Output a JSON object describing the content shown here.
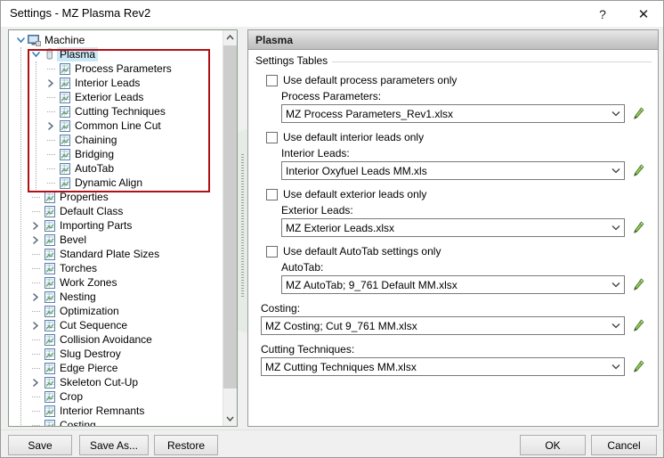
{
  "window": {
    "title": "Settings - MZ Plasma Rev2",
    "help_label": "?",
    "close_label": "✕"
  },
  "tree": {
    "nodes": [
      {
        "label": "Machine",
        "depth": 0,
        "expander": "expanded",
        "icon": "monitor-icon",
        "selected": false
      },
      {
        "label": "Plasma",
        "depth": 1,
        "expander": "expanded",
        "icon": "torch-icon",
        "selected": true
      },
      {
        "label": "Process Parameters",
        "depth": 2,
        "expander": "none",
        "icon": "spreadsheet-icon",
        "selected": false
      },
      {
        "label": "Interior Leads",
        "depth": 2,
        "expander": "collapsed",
        "icon": "spreadsheet-icon",
        "selected": false
      },
      {
        "label": "Exterior Leads",
        "depth": 2,
        "expander": "none",
        "icon": "spreadsheet-icon",
        "selected": false
      },
      {
        "label": "Cutting Techniques",
        "depth": 2,
        "expander": "none",
        "icon": "spreadsheet-icon",
        "selected": false
      },
      {
        "label": "Common Line Cut",
        "depth": 2,
        "expander": "collapsed",
        "icon": "spreadsheet-icon",
        "selected": false
      },
      {
        "label": "Chaining",
        "depth": 2,
        "expander": "none",
        "icon": "spreadsheet-icon",
        "selected": false
      },
      {
        "label": "Bridging",
        "depth": 2,
        "expander": "none",
        "icon": "spreadsheet-icon",
        "selected": false
      },
      {
        "label": "AutoTab",
        "depth": 2,
        "expander": "none",
        "icon": "spreadsheet-icon",
        "selected": false
      },
      {
        "label": "Dynamic Align",
        "depth": 2,
        "expander": "none",
        "icon": "spreadsheet-icon",
        "selected": false
      },
      {
        "label": "Properties",
        "depth": 1,
        "expander": "none",
        "icon": "spreadsheet-icon",
        "selected": false
      },
      {
        "label": "Default Class",
        "depth": 1,
        "expander": "none",
        "icon": "spreadsheet-icon",
        "selected": false
      },
      {
        "label": "Importing Parts",
        "depth": 1,
        "expander": "collapsed",
        "icon": "spreadsheet-icon",
        "selected": false
      },
      {
        "label": "Bevel",
        "depth": 1,
        "expander": "collapsed",
        "icon": "spreadsheet-icon",
        "selected": false
      },
      {
        "label": "Standard Plate Sizes",
        "depth": 1,
        "expander": "none",
        "icon": "spreadsheet-icon",
        "selected": false
      },
      {
        "label": "Torches",
        "depth": 1,
        "expander": "none",
        "icon": "spreadsheet-icon",
        "selected": false
      },
      {
        "label": "Work Zones",
        "depth": 1,
        "expander": "none",
        "icon": "spreadsheet-icon",
        "selected": false
      },
      {
        "label": "Nesting",
        "depth": 1,
        "expander": "collapsed",
        "icon": "spreadsheet-icon",
        "selected": false
      },
      {
        "label": "Optimization",
        "depth": 1,
        "expander": "none",
        "icon": "spreadsheet-icon",
        "selected": false
      },
      {
        "label": "Cut Sequence",
        "depth": 1,
        "expander": "collapsed",
        "icon": "spreadsheet-icon",
        "selected": false
      },
      {
        "label": "Collision Avoidance",
        "depth": 1,
        "expander": "none",
        "icon": "spreadsheet-icon",
        "selected": false
      },
      {
        "label": "Slug Destroy",
        "depth": 1,
        "expander": "none",
        "icon": "spreadsheet-icon",
        "selected": false
      },
      {
        "label": "Edge Pierce",
        "depth": 1,
        "expander": "none",
        "icon": "spreadsheet-icon",
        "selected": false
      },
      {
        "label": "Skeleton Cut-Up",
        "depth": 1,
        "expander": "collapsed",
        "icon": "spreadsheet-icon",
        "selected": false
      },
      {
        "label": "Crop",
        "depth": 1,
        "expander": "none",
        "icon": "spreadsheet-icon",
        "selected": false
      },
      {
        "label": "Interior Remnants",
        "depth": 1,
        "expander": "none",
        "icon": "spreadsheet-icon",
        "selected": false
      },
      {
        "label": "Costing",
        "depth": 1,
        "expander": "none",
        "icon": "spreadsheet-icon",
        "selected": false
      }
    ],
    "highlight_color": "#b01117",
    "selection_color": "#cbe8f6"
  },
  "panel": {
    "header_title": "Plasma",
    "group_legend": "Settings Tables",
    "fields": [
      {
        "checkbox_label": "Use default process parameters only",
        "checked": false,
        "field_label": "Process Parameters:",
        "value": "MZ Process Parameters_Rev1.xlsx",
        "has_checkbox": true
      },
      {
        "checkbox_label": "Use default interior leads only",
        "checked": false,
        "field_label": "Interior Leads:",
        "value": "Interior Oxyfuel Leads MM.xls",
        "has_checkbox": true
      },
      {
        "checkbox_label": "Use default exterior leads only",
        "checked": false,
        "field_label": "Exterior Leads:",
        "value": "MZ Exterior Leads.xlsx",
        "has_checkbox": true
      },
      {
        "checkbox_label": "Use default AutoTab settings only",
        "checked": false,
        "field_label": "AutoTab:",
        "value": "MZ AutoTab; 9_761 Default MM.xlsx",
        "has_checkbox": true
      },
      {
        "checkbox_label": "",
        "checked": false,
        "field_label": "Costing:",
        "value": "MZ Costing; Cut 9_761 MM.xlsx",
        "has_checkbox": false
      },
      {
        "checkbox_label": "",
        "checked": false,
        "field_label": "Cutting Techniques:",
        "value": "MZ Cutting Techniques MM.xlsx",
        "has_checkbox": false
      }
    ],
    "edit_icon_name": "pencil-icon",
    "dropdown_chevron": "⌄"
  },
  "footer": {
    "save": "Save",
    "save_as": "Save As...",
    "restore": "Restore",
    "ok": "OK",
    "cancel": "Cancel"
  }
}
